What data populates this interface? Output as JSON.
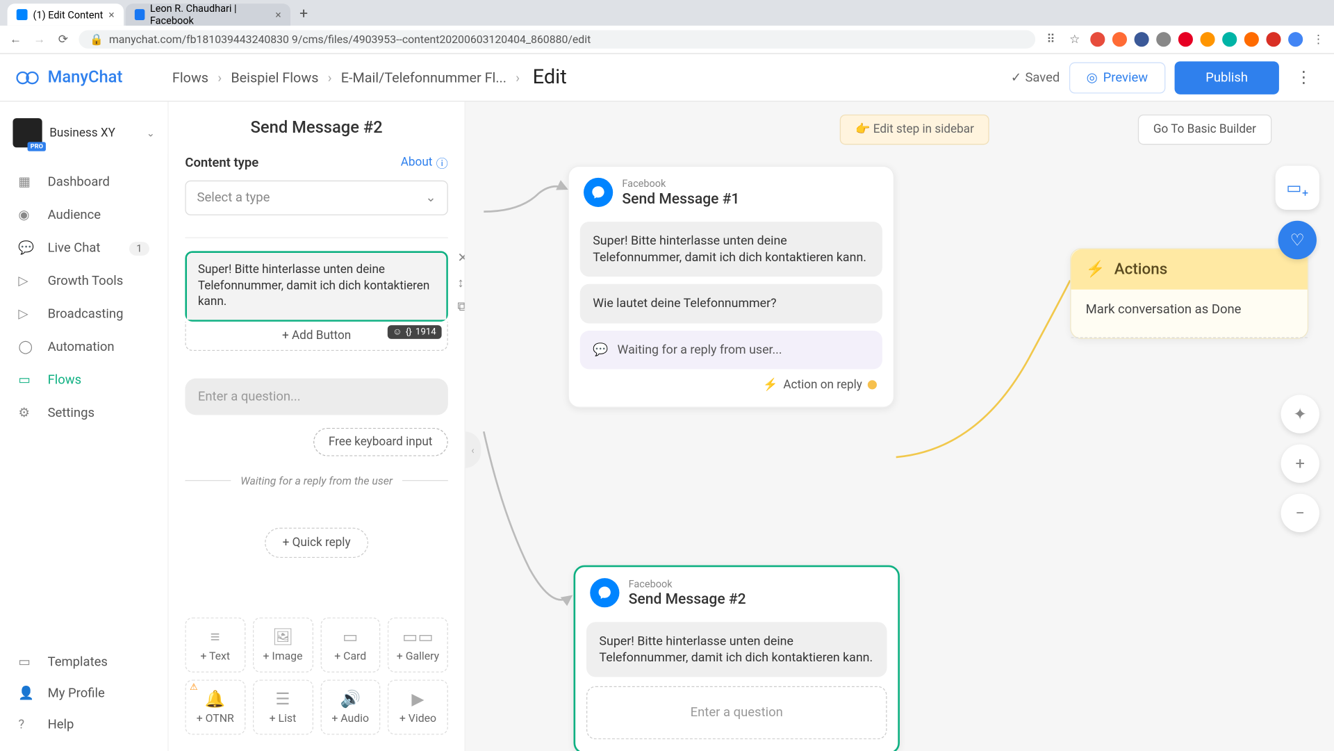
{
  "browser": {
    "tabs": [
      {
        "title": "(1) Edit Content",
        "favicon": "#0084ff"
      },
      {
        "title": "Leon R. Chaudhari | Facebook",
        "favicon": "#1877f2"
      }
    ],
    "url": "manychat.com/fb181039443240830 9/cms/files/4903953--content20200603120404_860880/edit"
  },
  "app": {
    "brand": "ManyChat",
    "workspace": "Business XY",
    "pro_label": "PRO",
    "breadcrumbs": [
      "Flows",
      "Beispiel Flows",
      "E-Mail/Telefonnummer Fl...",
      "Edit"
    ],
    "saved": "Saved",
    "preview": "Preview",
    "publish": "Publish"
  },
  "nav": {
    "items": [
      {
        "label": "Dashboard"
      },
      {
        "label": "Audience"
      },
      {
        "label": "Live Chat",
        "badge": "1"
      },
      {
        "label": "Growth Tools"
      },
      {
        "label": "Broadcasting"
      },
      {
        "label": "Automation"
      },
      {
        "label": "Flows",
        "active": true
      },
      {
        "label": "Settings"
      }
    ],
    "bottom": [
      {
        "label": "Templates"
      },
      {
        "label": "My Profile"
      },
      {
        "label": "Help"
      }
    ]
  },
  "editor": {
    "step_title": "Send Message #2",
    "content_type_label": "Content type",
    "about": "About",
    "select_placeholder": "Select a type",
    "message_text": "Super! Bitte hinterlasse unten deine Telefonnummer, damit ich dich kontaktieren kann.",
    "add_button": "+ Add Button",
    "char_count": "1914",
    "question_placeholder": "Enter a question...",
    "free_keyboard": "Free keyboard input",
    "waiting_text": "Waiting for a reply from the user",
    "quick_reply": "+ Quick reply",
    "block_types": [
      "+ Text",
      "+ Image",
      "+ Card",
      "+ Gallery",
      "+ OTNR",
      "+ List",
      "+ Audio",
      "+ Video"
    ]
  },
  "canvas": {
    "edit_sidebar": "Edit step in sidebar",
    "goto_basic": "Go To Basic Builder",
    "node1": {
      "channel": "Facebook",
      "title": "Send Message #1",
      "msg": "Super! Bitte hinterlasse unten deine Telefonnummer, damit ich dich kontaktieren kann.",
      "q": "Wie lautet deine Telefonnummer?",
      "waiting": "Waiting for a reply from user...",
      "action_reply": "Action on reply"
    },
    "node2": {
      "channel": "Facebook",
      "title": "Send Message #2",
      "msg": "Super! Bitte hinterlasse unten deine Telefonnummer, damit ich dich kontaktieren kann.",
      "enter_q": "Enter a question"
    },
    "actions": {
      "title": "Actions",
      "item": "Mark conversation as Done"
    }
  }
}
